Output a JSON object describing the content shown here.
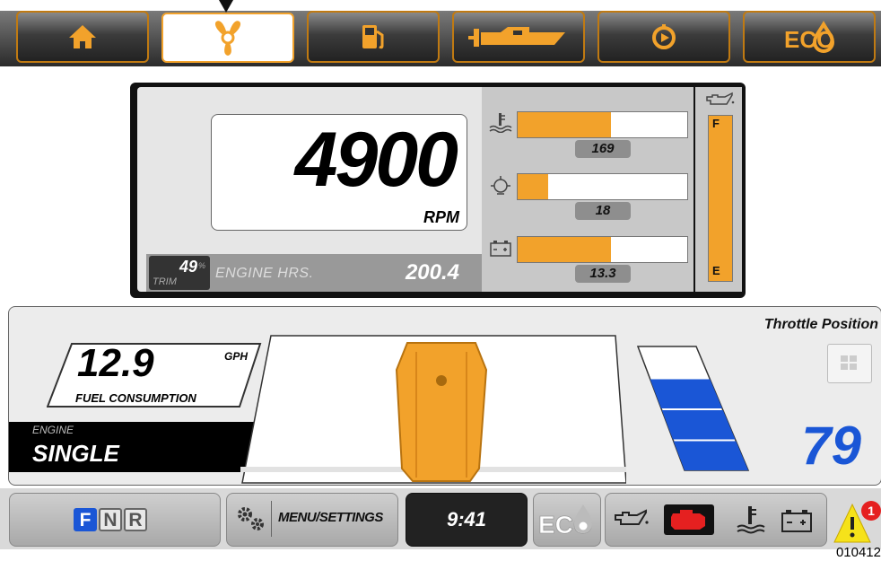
{
  "tabs": [
    {
      "name": "home-icon"
    },
    {
      "name": "propeller-icon"
    },
    {
      "name": "fuel-pump-icon"
    },
    {
      "name": "boat-icon"
    },
    {
      "name": "power-icon"
    },
    {
      "name": "eco-icon",
      "label": "ECO"
    }
  ],
  "engine": {
    "rpm": "4900",
    "rpm_unit": "RPM",
    "trim": "49",
    "trim_unit": "%",
    "trim_label": "TRIM",
    "hours_label": "ENGINE HRS.",
    "hours": "200.4"
  },
  "gauges": [
    {
      "icon": "water-temperature-icon",
      "value": "169",
      "fill": 0.55
    },
    {
      "icon": "oil-pressure-icon",
      "value": "18",
      "fill": 0.18
    },
    {
      "icon": "battery-icon",
      "value": "13.3",
      "fill": 0.55
    }
  ],
  "fuel_level": {
    "icon": "oil-can-icon",
    "full_label": "F",
    "empty_label": "E"
  },
  "fuel_consumption": {
    "value": "12.9",
    "unit": "GPH",
    "label": "FUEL CONSUMPTION"
  },
  "engine_select": {
    "label": "ENGINE",
    "value": "SINGLE"
  },
  "throttle": {
    "title": "Throttle Position",
    "value": "79",
    "level": 0.79
  },
  "bottom": {
    "gear": [
      "F",
      "N",
      "R"
    ],
    "menu_label": "MENU/SETTINGS",
    "time": "9:41",
    "eco_label": "ECO",
    "warning_count": "1",
    "warning_icons": [
      "oil-pressure-warning-icon",
      "engine-check-icon",
      "temperature-warning-icon",
      "battery-warning-icon"
    ]
  },
  "reference_id": "010412",
  "colors": {
    "accent": "#f2a22b",
    "throttle_blue": "#1a56d6",
    "alert_red": "#e52020"
  }
}
